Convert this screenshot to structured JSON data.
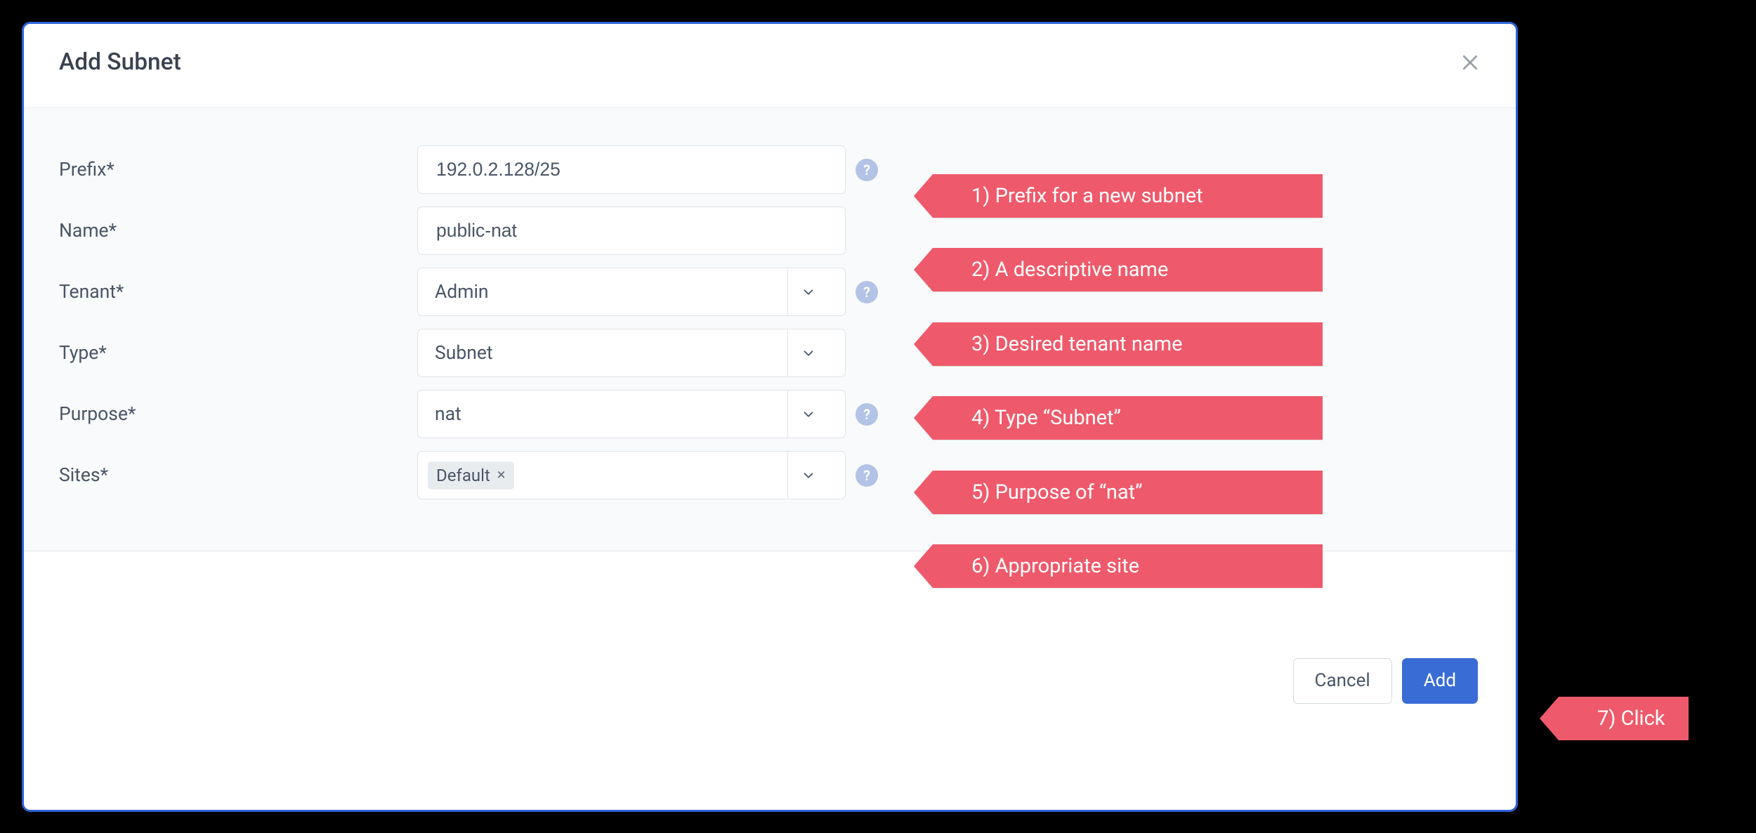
{
  "modal": {
    "title": "Add Subnet"
  },
  "form": {
    "prefix": {
      "label": "Prefix*",
      "value": "192.0.2.128/25",
      "help": "?"
    },
    "name": {
      "label": "Name*",
      "value": "public-nat"
    },
    "tenant": {
      "label": "Tenant*",
      "value": "Admin",
      "help": "?"
    },
    "type": {
      "label": "Type*",
      "value": "Subnet"
    },
    "purpose": {
      "label": "Purpose*",
      "value": "nat",
      "help": "?"
    },
    "sites": {
      "label": "Sites*",
      "chip": "Default",
      "help": "?"
    }
  },
  "footer": {
    "cancel": "Cancel",
    "add": "Add"
  },
  "annotations": {
    "a1": "1) Prefix for a new subnet",
    "a2": "2) A descriptive name",
    "a3": "3) Desired tenant name",
    "a4": "4) Type “Subnet”",
    "a5": "5) Purpose of “nat”",
    "a6": "6) Appropriate site",
    "a7": "7) Click"
  }
}
